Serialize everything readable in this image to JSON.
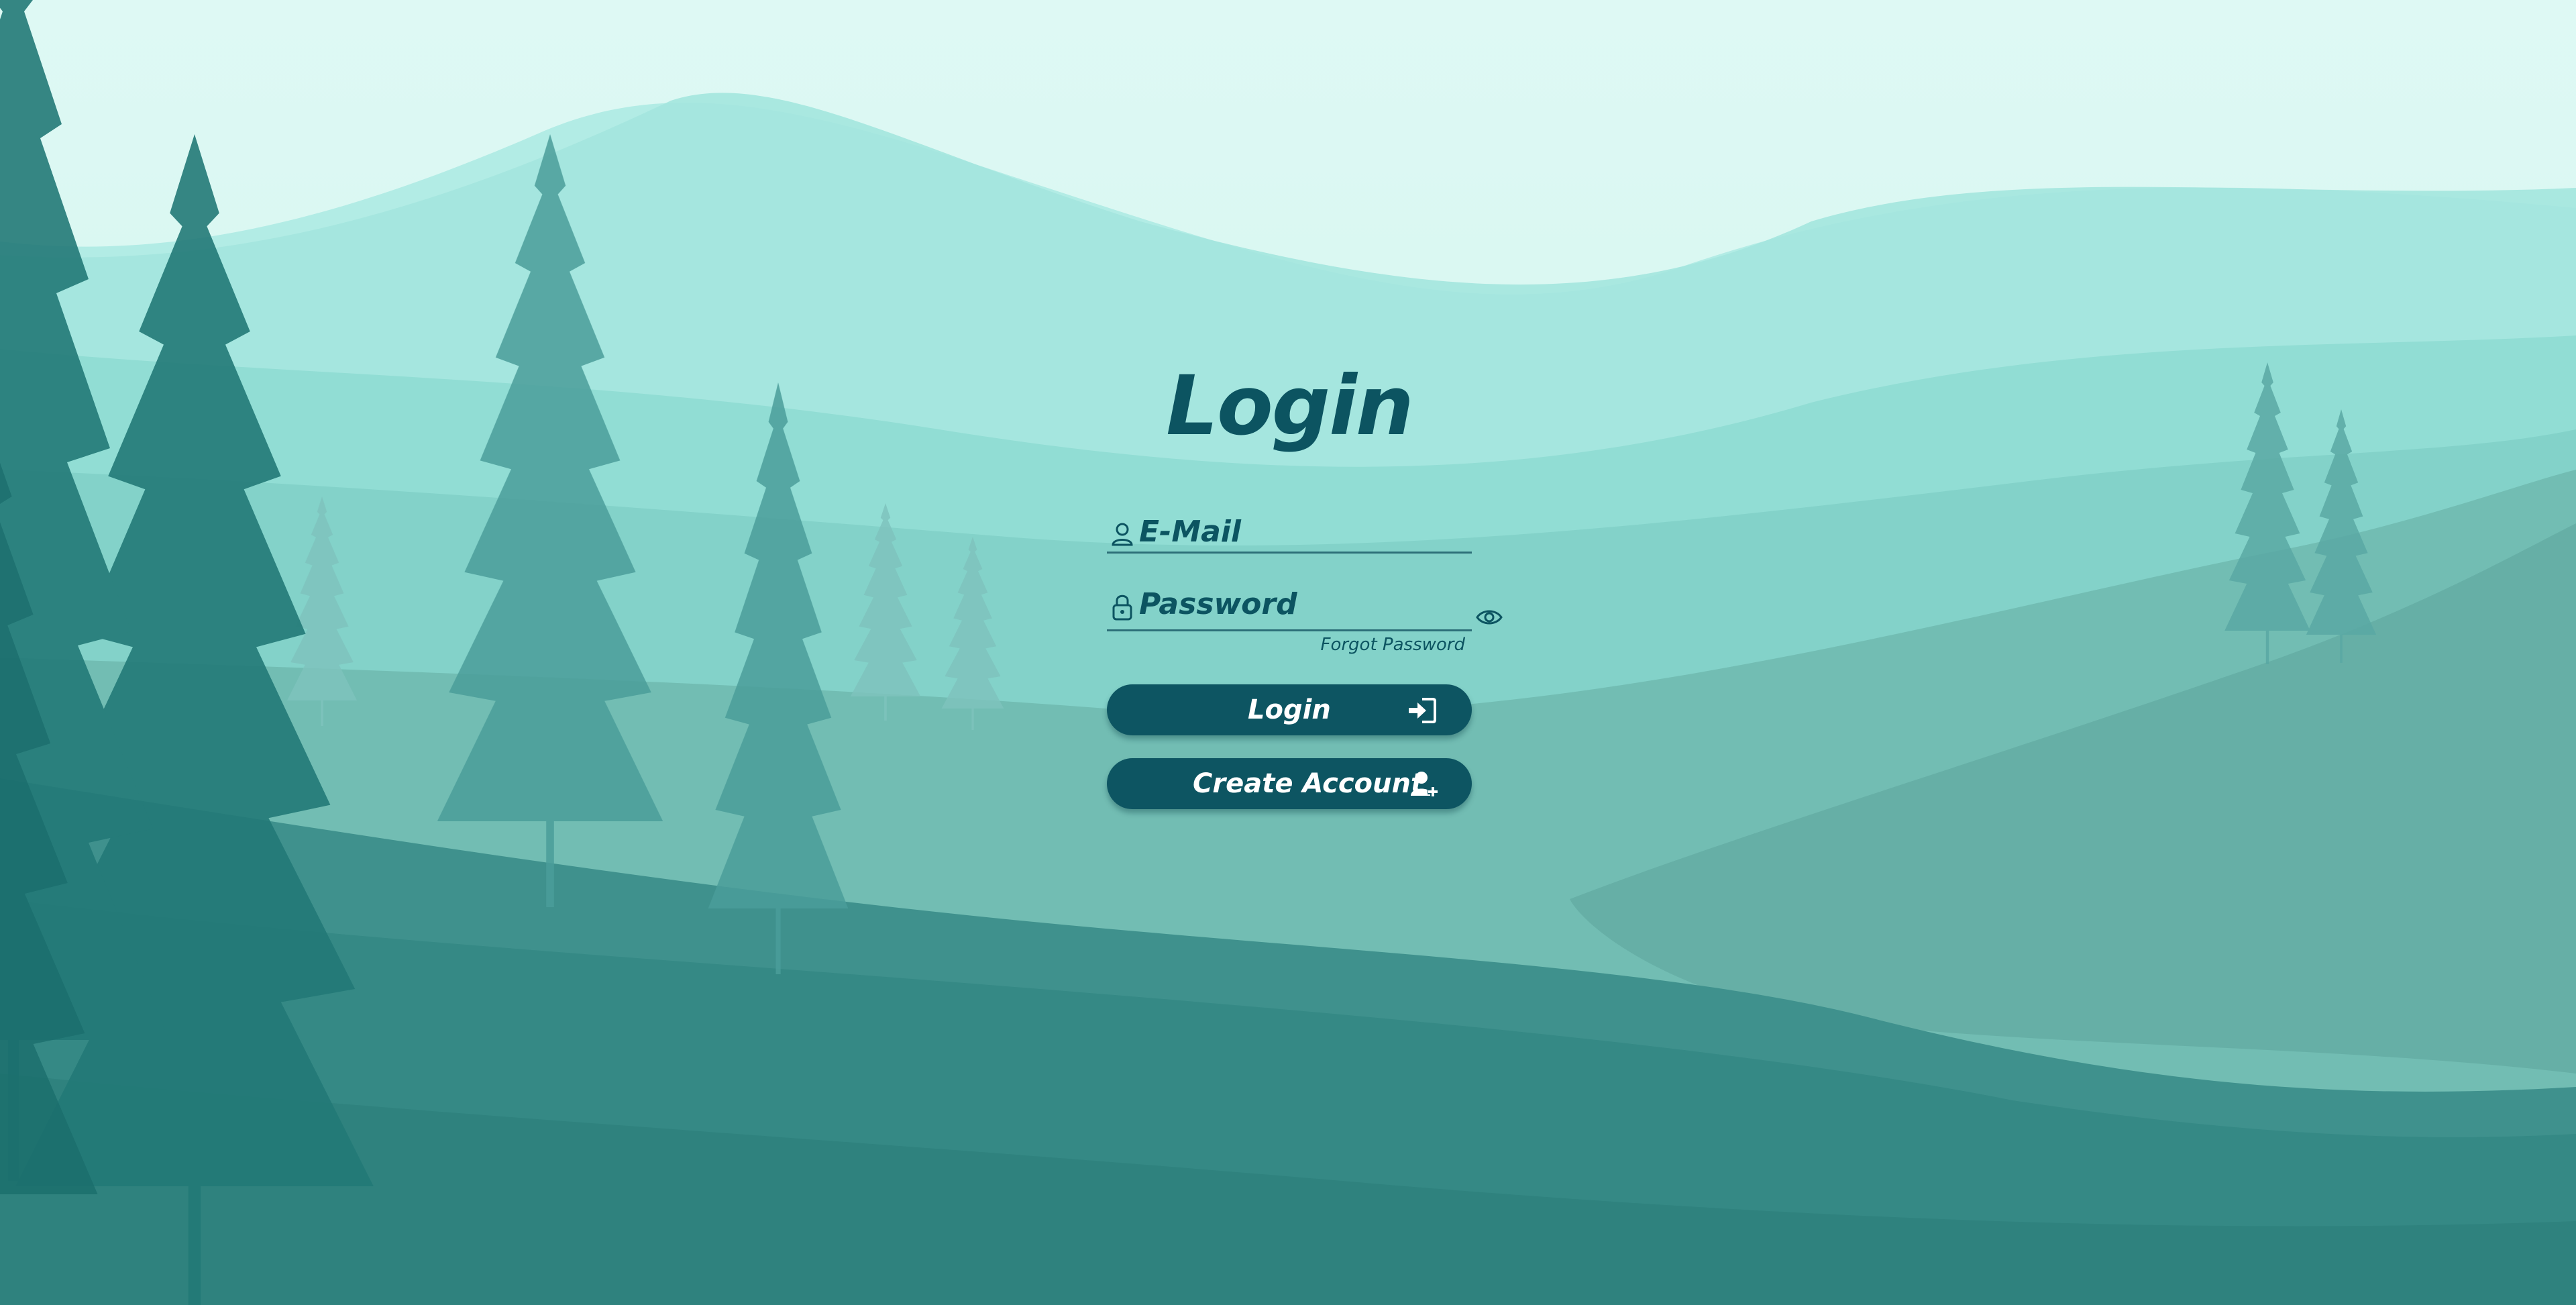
{
  "page": {
    "title": "Login"
  },
  "form": {
    "email": {
      "placeholder": "E-Mail",
      "value": "",
      "icon": "user-icon"
    },
    "password": {
      "placeholder": "Password",
      "value": "",
      "icon": "lock-icon",
      "toggle_icon": "eye-icon"
    },
    "forgot_password": "Forgot Password",
    "login_button": {
      "label": "Login",
      "icon": "sign-in-icon"
    },
    "create_account_button": {
      "label": "Create Account",
      "icon": "user-plus-icon"
    }
  },
  "colors": {
    "primary": "#0d5562",
    "sky": "#d6f6f0",
    "button_text": "#ffffff"
  }
}
